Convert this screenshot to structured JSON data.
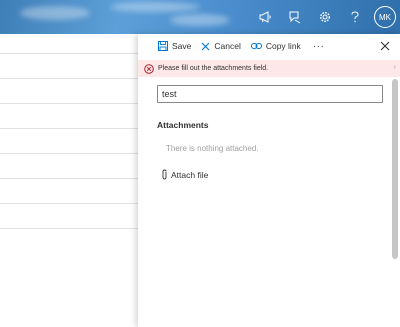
{
  "header": {
    "avatar_initials": "MK",
    "icons": [
      "megaphone-icon",
      "feedback-icon",
      "gear-icon",
      "help-icon"
    ]
  },
  "panel": {
    "commands": {
      "save_label": "Save",
      "cancel_label": "Cancel",
      "copy_link_label": "Copy link",
      "more_label": "···"
    },
    "error_message": "Please fill out the attachments field.",
    "title_value": "test",
    "attachments_label": "Attachments",
    "attachments_empty": "There is nothing attached.",
    "attach_file_label": "Attach file"
  },
  "colors": {
    "error_background": "#fde7e9",
    "error_icon": "#a4262c",
    "header_blue": "#4c8fcf",
    "command_blue": "#0078d4"
  }
}
